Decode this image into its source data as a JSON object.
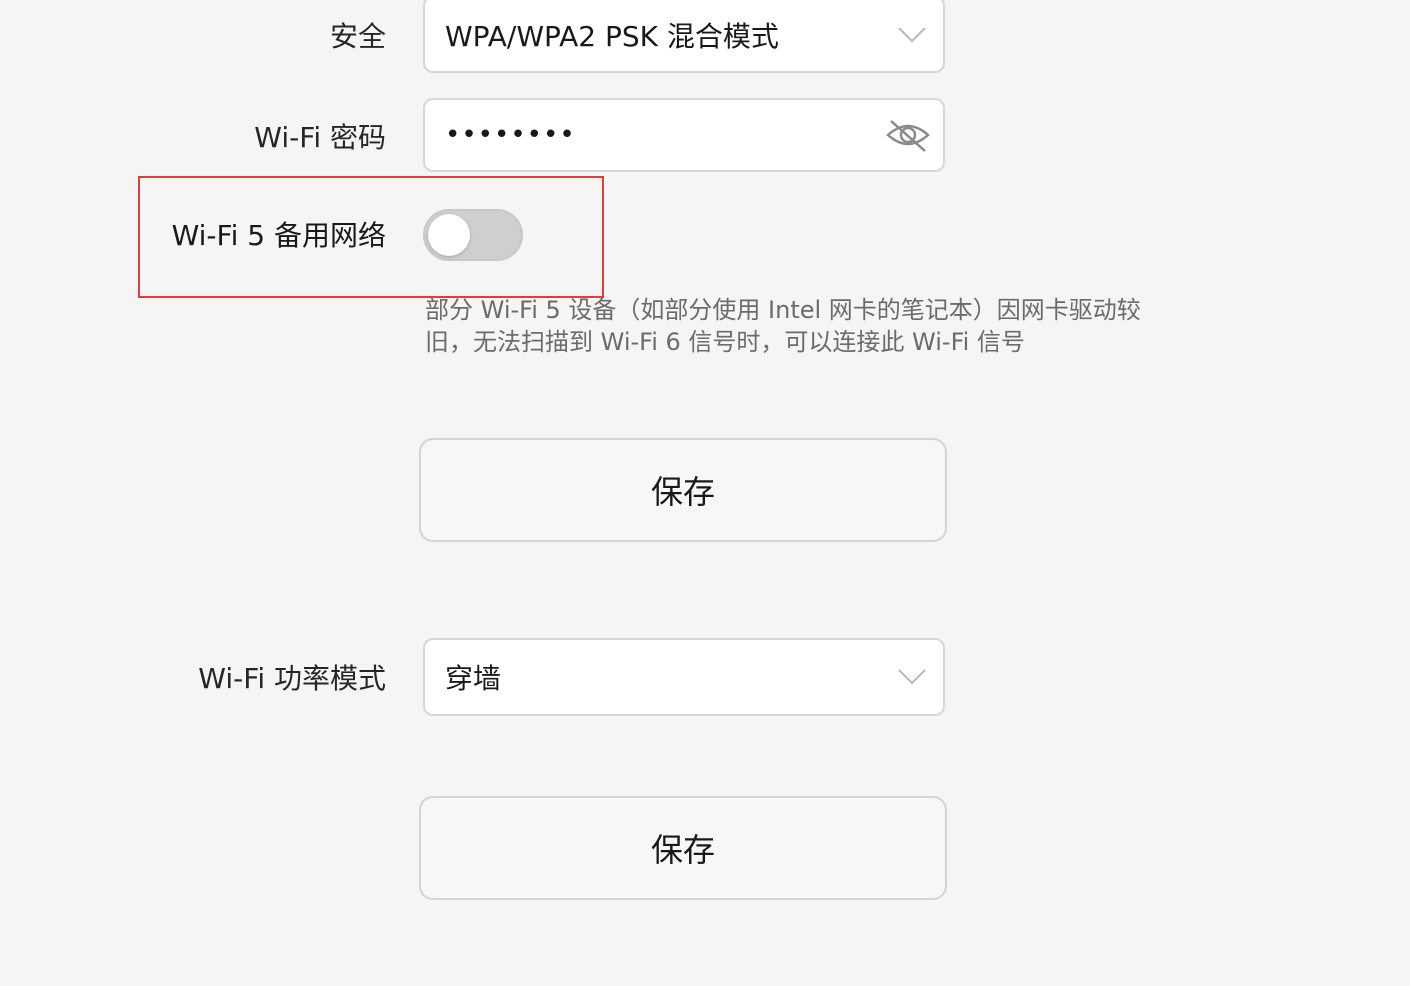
{
  "security": {
    "label": "安全",
    "value": "WPA/WPA2 PSK 混合模式"
  },
  "password": {
    "label": "Wi-Fi 密码",
    "value": "••••••••",
    "visibility_icon": "eye-hidden-icon"
  },
  "wifi5_backup": {
    "label": "Wi-Fi 5 备用网络",
    "enabled": false,
    "hint": "部分 Wi-Fi 5 设备（如部分使用 Intel 网卡的笔记本）因网卡驱动较旧，无法扫描到 Wi-Fi 6 信号时，可以连接此 Wi-Fi 信号"
  },
  "save_button_1": {
    "label": "保存"
  },
  "power_mode": {
    "label": "Wi-Fi 功率模式",
    "value": "穿墙"
  },
  "save_button_2": {
    "label": "保存"
  },
  "colors": {
    "background": "#f5f5f5",
    "highlight_border": "#e23b3b",
    "toggle_off": "#cfcfcf"
  }
}
